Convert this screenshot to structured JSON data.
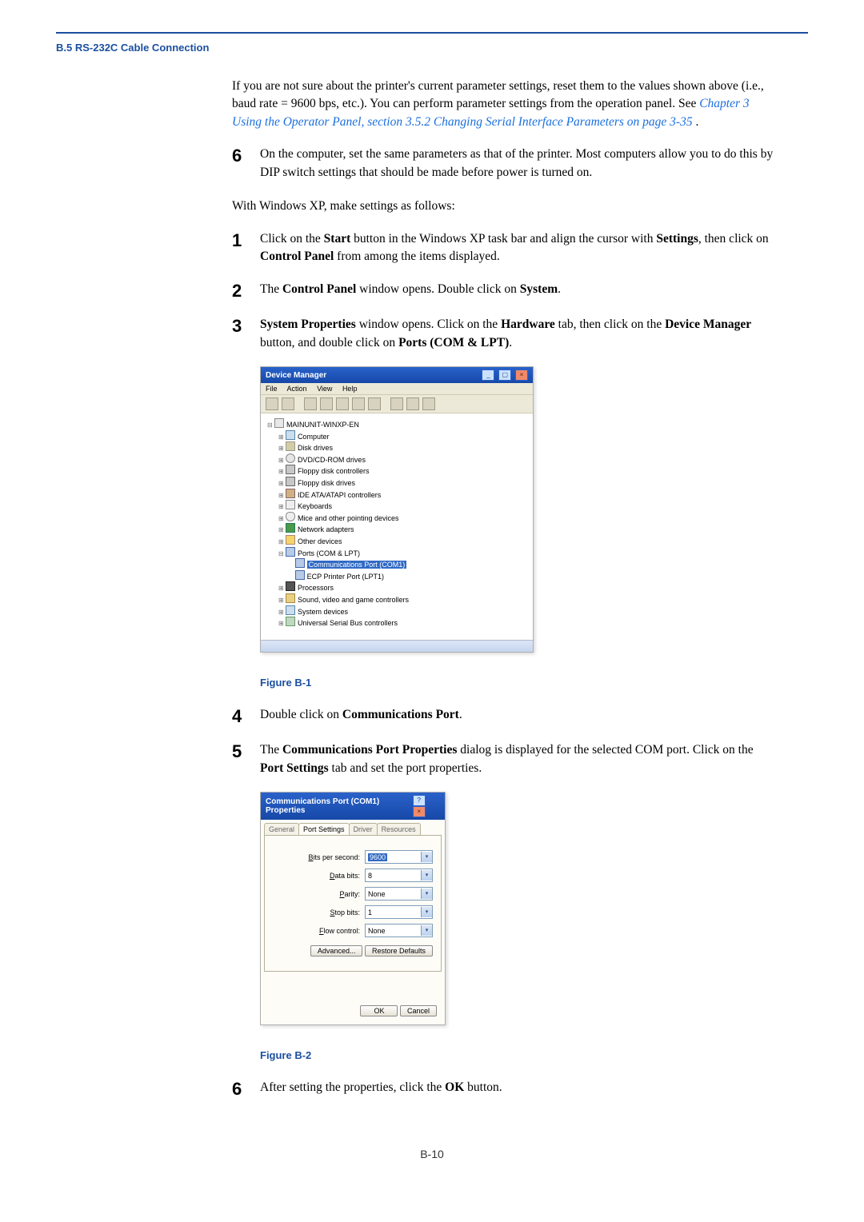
{
  "running_head": "B.5 RS-232C Cable Connection",
  "intro": {
    "text_before_link": "If you are not sure about the printer's current parameter settings, reset them to the values shown above (i.e., baud rate = 9600 bps, etc.). You can perform parameter settings from the operation panel. See ",
    "link_text": "Chapter 3 Using the Operator Panel, section 3.5.2 Changing Serial Interface Parameters on page 3-35",
    "text_after_link": "."
  },
  "step_pre6": {
    "num": "6",
    "text": "On the computer, set the same parameters as that of the printer. Most computers allow you to do this by DIP switch settings that should be made before power is turned on."
  },
  "xp_intro": "With Windows XP, make settings as follows:",
  "steps": {
    "s1": {
      "num": "1",
      "p1": "Click on the ",
      "b1": "Start",
      "p2": " button in the Windows XP task bar and align the cursor with ",
      "b2": "Settings",
      "p3": ", then click on ",
      "b3": "Control Panel",
      "p4": " from among the items displayed."
    },
    "s2": {
      "num": "2",
      "p1": "The ",
      "b1": "Control Panel",
      "p2": " window opens. Double click on ",
      "b2": "System",
      "p3": "."
    },
    "s3": {
      "num": "3",
      "b1": "System Properties",
      "p1": " window opens. Click on the ",
      "b2": "Hardware",
      "p2": " tab, then click on the ",
      "b3": "Device Manager",
      "p3": " button, and double click on ",
      "b4": "Ports (COM & LPT)",
      "p4": "."
    },
    "s4": {
      "num": "4",
      "p1": "Double click on ",
      "b1": "Communications Port",
      "p2": "."
    },
    "s5": {
      "num": "5",
      "p1": "The ",
      "b1": "Communications Port Properties",
      "p2": " dialog is displayed for the selected COM port. Click on the ",
      "b2": "Port Settings",
      "p3": " tab and set the port properties."
    },
    "s6": {
      "num": "6",
      "p1": "After setting the properties, click the ",
      "b1": "OK",
      "p2": " button."
    }
  },
  "figB1": {
    "caption": "Figure B-1",
    "title": "Device Manager",
    "menu": {
      "file": "File",
      "action": "Action",
      "view": "View",
      "help": "Help"
    },
    "root": "MAINUNIT-WINXP-EN",
    "items": {
      "computer": "Computer",
      "disk": "Disk drives",
      "cd": "DVD/CD-ROM drives",
      "floppyctl": "Floppy disk controllers",
      "floppy": "Floppy disk drives",
      "ide": "IDE ATA/ATAPI controllers",
      "keyboard": "Keyboards",
      "mouse": "Mice and other pointing devices",
      "network": "Network adapters",
      "other": "Other devices",
      "ports": "Ports (COM & LPT)",
      "com1": "Communications Port (COM1)",
      "lpt1": "ECP Printer Port (LPT1)",
      "cpu": "Processors",
      "sound": "Sound, video and game controllers",
      "system": "System devices",
      "usb": "Universal Serial Bus controllers"
    }
  },
  "figB2": {
    "caption": "Figure B-2",
    "title": "Communications Port (COM1) Properties",
    "tabs": {
      "general": "General",
      "port": "Port Settings",
      "driver": "Driver",
      "resources": "Resources"
    },
    "fields": {
      "bps_label": "Bits per second:",
      "bps_value": "9600",
      "data_label": "Data bits:",
      "data_value": "8",
      "parity_label": "Parity:",
      "parity_value": "None",
      "stop_label": "Stop bits:",
      "stop_value": "1",
      "flow_label": "Flow control:",
      "flow_value": "None"
    },
    "buttons": {
      "advanced": "Advanced...",
      "restore": "Restore Defaults",
      "ok": "OK",
      "cancel": "Cancel"
    }
  },
  "page_number": "B-10"
}
